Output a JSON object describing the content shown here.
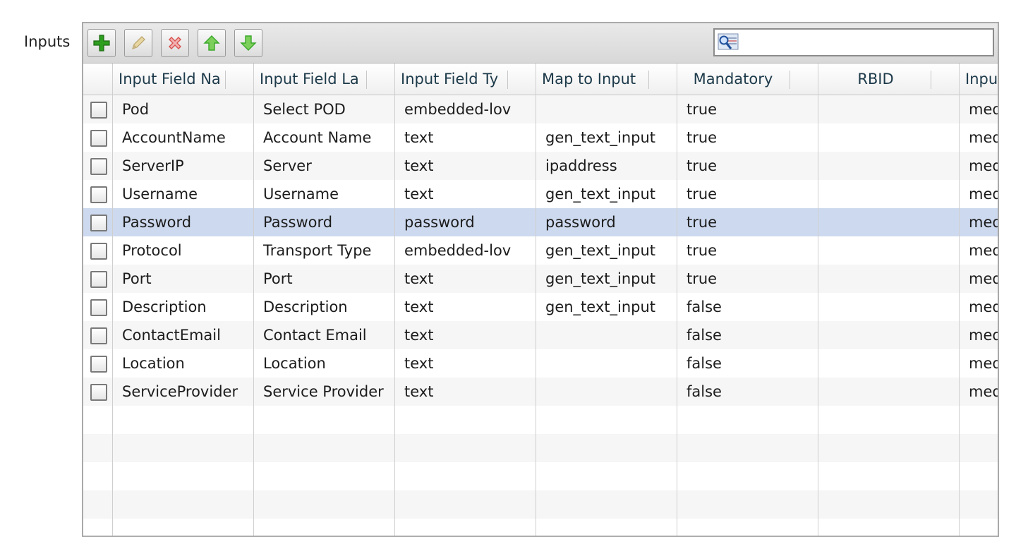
{
  "form": {
    "label": "Inputs"
  },
  "toolbar": {
    "buttons": [
      {
        "name": "add-button",
        "icon": "plus-icon"
      },
      {
        "name": "edit-button",
        "icon": "pencil-icon"
      },
      {
        "name": "delete-button",
        "icon": "delete-x-icon"
      },
      {
        "name": "move-up-button",
        "icon": "arrow-up-icon"
      },
      {
        "name": "move-down-button",
        "icon": "arrow-down-icon"
      }
    ],
    "search": {
      "icon": "search-icon",
      "value": ""
    }
  },
  "table": {
    "columns": [
      "Input Field Na",
      "Input Field La",
      "Input Field Ty",
      "Map to Input ",
      "Mandatory",
      "RBID",
      "Inpu"
    ],
    "rows": [
      [
        "Pod",
        "Select POD",
        "embedded-lov",
        "",
        "true",
        "",
        "med"
      ],
      [
        "AccountName",
        "Account Name",
        "text",
        "gen_text_input",
        "true",
        "",
        "med"
      ],
      [
        "ServerIP",
        "Server",
        "text",
        "ipaddress",
        "true",
        "",
        "med"
      ],
      [
        "Username",
        "Username",
        "text",
        "gen_text_input",
        "true",
        "",
        "med"
      ],
      [
        "Password",
        "Password",
        "password",
        "password",
        "true",
        "",
        "med"
      ],
      [
        "Protocol",
        "Transport Type",
        "embedded-lov",
        "gen_text_input",
        "true",
        "",
        "med"
      ],
      [
        "Port",
        "Port",
        "text",
        "gen_text_input",
        "true",
        "",
        "med"
      ],
      [
        "Description",
        "Description",
        "text",
        "gen_text_input",
        "false",
        "",
        "med"
      ],
      [
        "ContactEmail",
        "Contact Email",
        "text",
        "",
        "false",
        "",
        "med"
      ],
      [
        "Location",
        "Location",
        "text",
        "",
        "false",
        "",
        "med"
      ],
      [
        "ServiceProvider",
        "Service Provider",
        "text",
        "",
        "false",
        "",
        "med"
      ]
    ],
    "selected_row": 4
  },
  "colors": {
    "selected_row": "#cdd9ee",
    "alt_row": "#f6f6f6",
    "header_text": "#1d3a4a",
    "add_icon": "#2e9e1f",
    "delete_icon": "#d9534f",
    "arrow_icon": "#3aa72a"
  }
}
